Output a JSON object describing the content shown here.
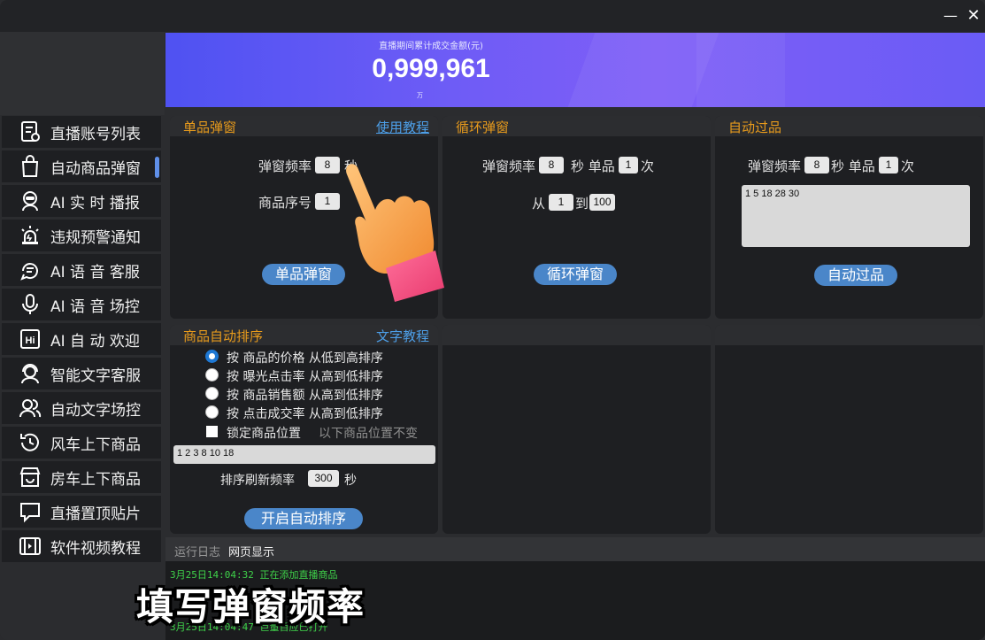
{
  "window": {
    "minimize_icon": "minimize-icon",
    "close_icon": "close-icon"
  },
  "sidebar": {
    "items": [
      {
        "label": "直播账号列表",
        "icon": "account-list-icon"
      },
      {
        "label": "自动商品弹窗",
        "icon": "bag-icon",
        "active": true
      },
      {
        "label": "AI 实 时 播报",
        "icon": "robot-icon"
      },
      {
        "label": "违规预警通知",
        "icon": "alarm-icon"
      },
      {
        "label": "AI 语 音 客服",
        "icon": "voice-service-icon"
      },
      {
        "label": "AI 语 音 场控",
        "icon": "microphone-icon"
      },
      {
        "label": "AI 自 动 欢迎",
        "icon": "hi-icon"
      },
      {
        "label": "智能文字客服",
        "icon": "agent-icon"
      },
      {
        "label": "自动文字场控",
        "icon": "users-icon"
      },
      {
        "label": "风车上下商品",
        "icon": "cycle-icon"
      },
      {
        "label": "房车上下商品",
        "icon": "store-icon"
      },
      {
        "label": "直播置顶贴片",
        "icon": "message-icon"
      },
      {
        "label": "软件视频教程",
        "icon": "video-icon"
      }
    ]
  },
  "banner": {
    "title": "直播期间累计成交金额(元)",
    "value": "0,999,961",
    "unit": "万"
  },
  "single_popup": {
    "title": "单品弹窗",
    "link": "使用教程",
    "freq_label": "弹窗频率",
    "freq_value": "8",
    "freq_unit": "秒",
    "index_label": "商品序号",
    "index_value": "1",
    "button": "单品弹窗"
  },
  "loop_popup": {
    "title": "循环弹窗",
    "freq_label": "弹窗频率",
    "freq_value": "8",
    "freq_unit": "秒 单品",
    "count_value": "1",
    "count_unit": "次",
    "from_label": "从",
    "from_value": "1",
    "to_label": "到",
    "to_value": "100",
    "button": "循环弹窗"
  },
  "auto_pass": {
    "title": "自动过品",
    "freq_label": "弹窗频率",
    "freq_value": "8",
    "freq_unit": "秒 单品",
    "count_value": "1",
    "count_unit": "次",
    "list_value": "1 5 18 28 30",
    "button": "自动过品"
  },
  "auto_sort": {
    "title": "商品自动排序",
    "link": "文字教程",
    "options": [
      {
        "label": "按 商品的价格 从低到高排序",
        "selected": true
      },
      {
        "label": "按 曝光点击率 从高到低排序",
        "selected": false
      },
      {
        "label": "按 商品销售额 从高到低排序",
        "selected": false
      },
      {
        "label": "按 点击成交率 从高到低排序",
        "selected": false
      }
    ],
    "lock_label": "锁定商品位置",
    "lock_hint": "以下商品位置不变",
    "positions_value": "1 2 3 8 10 18",
    "refresh_label": "排序刷新频率",
    "refresh_value": "300",
    "refresh_unit": "秒",
    "button": "开启自动排序"
  },
  "log": {
    "tab_log": "运行日志",
    "tab_web": "网页显示",
    "lines": [
      "3月25日14:04:32  正在添加直播商品",
      "3月25日14:04:47  巨量百应已打开"
    ]
  },
  "caption": "填写弹窗频率",
  "colors": {
    "accent": "#e89b1c",
    "link": "#4d9fe8",
    "button": "#4a86c9",
    "log_text": "#3fd24a"
  }
}
